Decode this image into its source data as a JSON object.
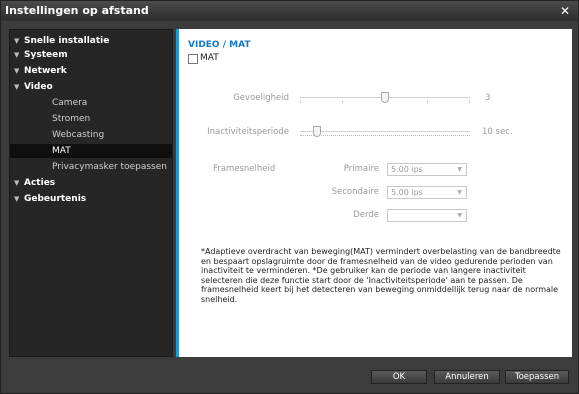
{
  "window": {
    "title": "Instellingen op afstand"
  },
  "sidebar": {
    "items": [
      {
        "label": "Snelle installatie",
        "level": 0
      },
      {
        "label": "Systeem",
        "level": 0
      },
      {
        "label": "Netwerk",
        "level": 0
      },
      {
        "label": "Video",
        "level": 0
      },
      {
        "label": "Camera",
        "level": 1
      },
      {
        "label": "Stromen",
        "level": 1
      },
      {
        "label": "Webcasting",
        "level": 1
      },
      {
        "label": "MAT",
        "level": 1,
        "selected": true
      },
      {
        "label": "Privacymasker toepassen",
        "level": 1
      },
      {
        "label": "Acties",
        "level": 0
      },
      {
        "label": "Gebeurtenis",
        "level": 0
      }
    ]
  },
  "panel": {
    "title": "VIDEO / MAT",
    "mat_checkbox_label": "MAT",
    "mat_checked": false,
    "sensitivity": {
      "label": "Gevoeligheid",
      "value": "3",
      "level": 0.5
    },
    "inactivity": {
      "label": "Inactiviteitsperiode",
      "value": "10 sec.",
      "level": 0.1
    },
    "framerate": {
      "label": "Framesnelheid",
      "primary_label": "Primaire",
      "primary_value": "5.00 ips",
      "secondary_label": "Secondaire",
      "secondary_value": "5.00 ips",
      "third_label": "Derde",
      "third_value": ""
    },
    "note": "*Adaptieve overdracht van beweging(MAT) vermindert overbelasting van de bandbreedte en bespaart opslagruimte door de framesnelheid van de video gedurende perioden van inactiviteit te verminderen. *De gebruiker kan de periode van langere inactiviteit selecteren die deze functie start door de 'Inactiviteitsperiode' aan te passen. De framesnelheid keert bij het detecteren van beweging onmiddellijk terug naar de normale snelheid."
  },
  "footer": {
    "ok_label": "OK",
    "cancel_label": "Annuleren",
    "apply_label": "Toepassen"
  }
}
